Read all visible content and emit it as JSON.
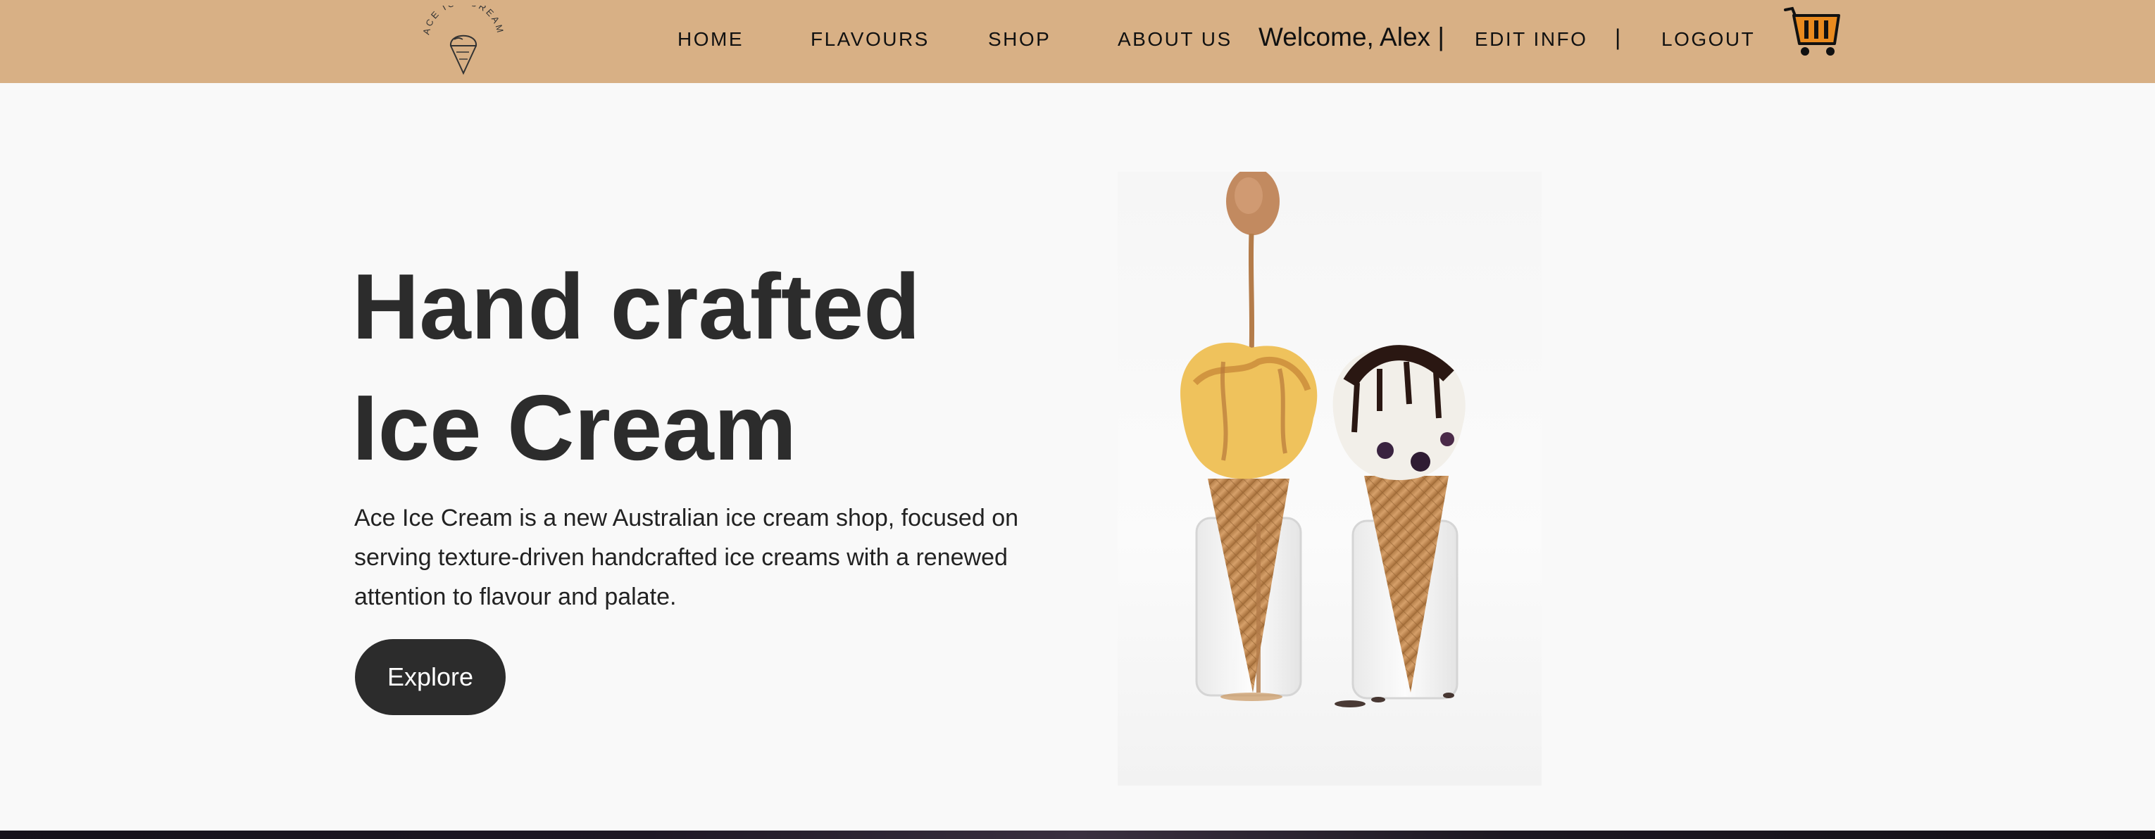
{
  "header": {
    "logo_text": "ACE ICE CREAM",
    "nav": {
      "home": "HOME",
      "flavours": "FLAVOURS",
      "shop": "SHOP",
      "about": "ABOUT US"
    },
    "welcome": "Welcome, Alex",
    "welcome_sep": "|",
    "edit_info": "EDIT INFO",
    "sep": "|",
    "logout": "LOGOUT",
    "cart_icon": "shopping-cart-icon"
  },
  "hero": {
    "title_line1": "Hand crafted",
    "title_line2": "Ice Cream",
    "description": "Ace Ice Cream is a new Australian ice cream shop, focused on serving texture-driven handcrafted ice creams with a renewed attention to flavour and palate.",
    "button_label": "Explore",
    "image_subject": "two ice cream cones in glass jars"
  },
  "colors": {
    "header_bg": "#d8b085",
    "page_bg": "#f9f9f9",
    "button_bg": "#2c2c2c",
    "cart_accent": "#e98a1e"
  }
}
